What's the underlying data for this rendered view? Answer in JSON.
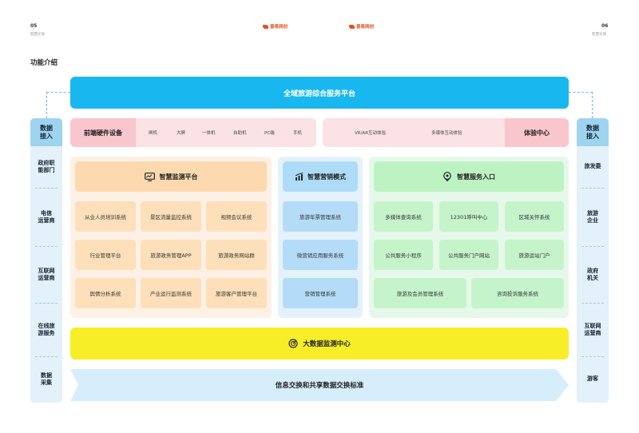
{
  "header": {
    "page_left": "05",
    "label_left": "智慧文旅",
    "logo_left_text": "普易网创",
    "logo_right_text": "普易网创",
    "page_right": "06",
    "label_right": "智慧文旅"
  },
  "section_title": "功能介绍",
  "top_banner": "全域旅游综合服务平台",
  "left_col": {
    "title": "数据\n接入",
    "items": [
      "政府职\n能部门",
      "电信\n运营商",
      "互联网\n运营商",
      "在线旅\n游服务",
      "数据\n采集"
    ]
  },
  "right_col": {
    "title": "数据\n接入",
    "items": [
      "旅发委",
      "旅游\n企业",
      "政府\n机关",
      "互联网\n运营商",
      "游客"
    ]
  },
  "hardware": {
    "label": "前端硬件设备",
    "items": [
      "闸机",
      "大屏",
      "一体机",
      "自助机",
      "PC端",
      "手机"
    ]
  },
  "experience": {
    "items": [
      "VR/AR互动体验",
      "多媒体互动体验"
    ],
    "label": "体验中心"
  },
  "monitor": {
    "title": "智慧监测平台",
    "cells": [
      "从业人员培训系统",
      "景区流量监控系统",
      "视频会议系统",
      "行业管理平台",
      "旅游政务管理APP",
      "旅游政务网站群",
      "舆情分析系统",
      "产业运行监测系统",
      "旅游客户管理平台"
    ]
  },
  "marketing": {
    "title": "智慧营销模式",
    "cells": [
      "旅游年票管理系统",
      "微营销应用服务系统",
      "营销管理系统"
    ]
  },
  "service": {
    "title": "智慧服务入口",
    "cells_row1": [
      "多媒体查询系统",
      "12301呼叫中心",
      "区域关怀系统"
    ],
    "cells_row2": [
      "公共服务小程序",
      "公共服务门户网站",
      "旅游运站门户"
    ],
    "cells_row3": [
      "旅游及会员管理系统",
      "咨询投诉服务系统"
    ]
  },
  "bigdata": {
    "title": "大数据监测中心"
  },
  "exchange": {
    "title": "信息交换和共享数据交换标准"
  },
  "colors": {
    "banner": "#18b7ef",
    "hardware": "#fbe2e5",
    "monitor": "#fdf1e5",
    "marketing": "#e4f2fc",
    "service": "#e6f8ea",
    "bigdata": "#f7ee27",
    "exchange": "#d6eefb"
  }
}
